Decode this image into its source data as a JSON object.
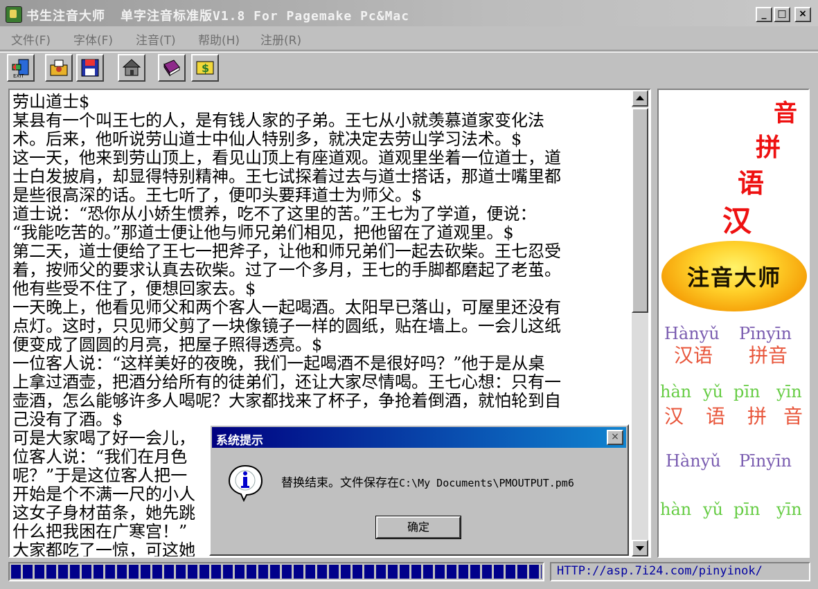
{
  "window": {
    "title": "书生注音大师",
    "subtitle": "单字注音标准版V1.8 For Pagemake Pc&Mac",
    "min": "_",
    "max": "□",
    "close": "×"
  },
  "menu": [
    {
      "label": "文件(F)"
    },
    {
      "label": "字体(F)"
    },
    {
      "label": "注音(T)"
    },
    {
      "label": "帮助(H)"
    },
    {
      "label": "注册(R)"
    }
  ],
  "toolbar": {
    "icons": [
      "exit-icon",
      "open-folder-icon",
      "save-icon",
      "home-icon",
      "book-icon",
      "money-icon"
    ]
  },
  "editor": {
    "lines": [
      "劳山道士$",
      "某县有一个叫王七的人，是有钱人家的子弟。王七从小就羡慕道家变化法",
      "术。后来，他听说劳山道士中仙人特别多，就决定去劳山学习法术。$",
      "这一天，他来到劳山顶上，看见山顶上有座道观。道观里坐着一位道士，道",
      "士白发披肩，却显得特别精神。王七试探着过去与道士搭话，那道士嘴里都",
      "是些很高深的话。王七听了，便叩头要拜道士为师父。$",
      "道士说：“恐你从小娇生惯养，吃不了这里的苦。”王七为了学道，便说：",
      "“我能吃苦的。”那道士便让他与师兄弟们相见，把他留在了道观里。$",
      "第二天，道士便给了王七一把斧子，让他和师兄弟们一起去砍柴。王七忍受",
      "着，按师父的要求认真去砍柴。过了一个多月，王七的手脚都磨起了老茧。",
      "他有些受不住了，便想回家去。$",
      "一天晚上，他看见师父和两个客人一起喝酒。太阳早已落山，可屋里还没有",
      "点灯。这时，只见师父剪了一块像镜子一样的圆纸，贴在墙上。一会儿这纸",
      "便变成了圆圆的月亮，把屋子照得透亮。$",
      "一位客人说：“这样美好的夜晚，我们一起喝酒不是很好吗？”他于是从桌",
      "上拿过酒壶，把酒分给所有的徒弟们，还让大家尽情喝。王七心想：只有一",
      "壶酒，怎么能够许多人喝呢？大家都找来了杯子，争抢着倒酒，就怕轮到自",
      "己没有了酒。$",
      "可是大家喝了好一会儿，",
      "位客人说：“我们在月色",
      "呢？”于是这位客人把一",
      "开始是个不满一尺的小人",
      "这女子身材苗条，她先跳",
      "什么把我困在广寒宫！”",
      "大家都吃了一惊，可这她"
    ]
  },
  "side_panel": {
    "chars": [
      "音",
      "拼",
      "语",
      "汉"
    ],
    "logo": "注音大师",
    "row1_pinyin": [
      "Hànyǔ",
      "Pīnyīn"
    ],
    "row1_hanzi": [
      "汉语",
      "拼音"
    ],
    "row2_pinyin": [
      "hàn",
      "yǔ",
      "pīn",
      "yīn"
    ],
    "row2_hanzi": [
      "汉",
      "语",
      "拼",
      "音"
    ],
    "row3_pinyin": [
      "Hànyǔ",
      "Pīnyīn"
    ],
    "row4_pinyin": [
      "hàn",
      "yǔ",
      "pīn",
      "yīn"
    ],
    "colors": {
      "red": "#ee1111",
      "purple": "#7a5cb0",
      "green": "#66cc44",
      "orange_red": "#e8553a"
    }
  },
  "status": {
    "progress": 1.0,
    "url": "HTTP://asp.7i24.com/pinyinok/"
  },
  "dialog": {
    "title": "系统提示",
    "message_cn": "替换结束。文件保存在",
    "message_path": "C:\\My Documents\\PMOUTPUT.pm6",
    "ok_label": "确定"
  }
}
